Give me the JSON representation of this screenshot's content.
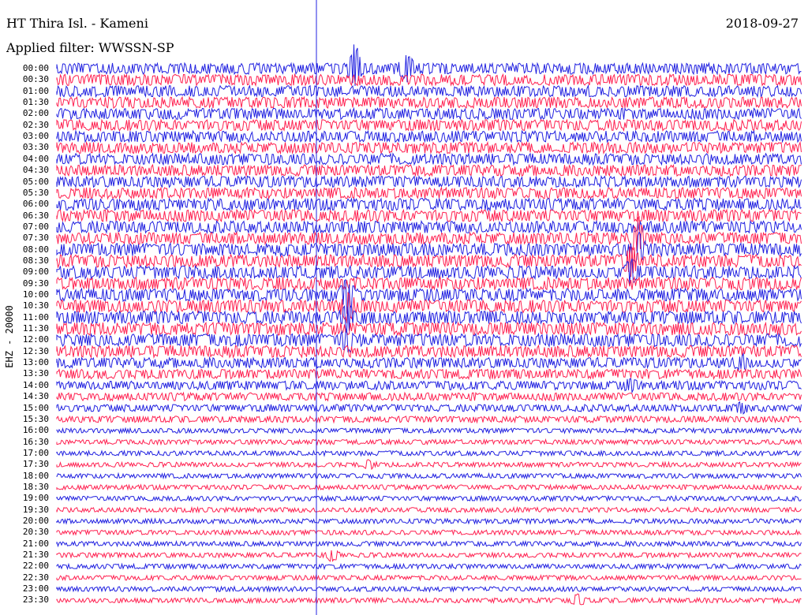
{
  "header": {
    "station": "HT Thira Isl. - Kameni",
    "date": "2018-09-27",
    "filter": "Applied filter: WWSSN-SP"
  },
  "chart_data": {
    "type": "line",
    "title": "HT Thira Isl. - Kameni",
    "ylabel": "EHZ - 20000",
    "row_labels": [
      "00:00",
      "00:30",
      "01:00",
      "01:30",
      "02:00",
      "02:30",
      "03:00",
      "03:30",
      "04:00",
      "04:30",
      "05:00",
      "05:30",
      "06:00",
      "06:30",
      "07:00",
      "07:30",
      "08:00",
      "08:30",
      "09:00",
      "09:30",
      "10:00",
      "10:30",
      "11:00",
      "11:30",
      "12:00",
      "12:30",
      "13:00",
      "13:30",
      "14:00",
      "14:30",
      "15:00",
      "15:30",
      "16:00",
      "16:30",
      "17:00",
      "17:30",
      "18:00",
      "18:30",
      "19:00",
      "19:30",
      "20:00",
      "20:30",
      "21:00",
      "21:30",
      "22:00",
      "22:30",
      "23:00",
      "23:30"
    ],
    "trace_colors": [
      "#2020e0",
      "#ff2050"
    ],
    "row_amplitude": [
      14,
      14,
      14,
      14,
      14,
      14,
      14,
      14,
      14,
      14,
      14,
      14,
      15,
      15,
      15,
      15,
      16,
      16,
      16,
      16,
      16,
      16,
      16,
      16,
      16,
      15,
      13,
      12,
      11,
      10,
      9,
      8,
      6,
      6,
      6,
      6,
      6,
      6,
      6,
      6,
      6,
      6,
      6,
      6,
      6,
      6,
      6,
      6
    ],
    "events": [
      {
        "row": 0,
        "x": 0.4,
        "amp": 60
      },
      {
        "row": 0,
        "x": 0.47,
        "amp": 28
      },
      {
        "row": 15,
        "x": 0.78,
        "amp": 50
      },
      {
        "row": 16,
        "x": 0.78,
        "amp": 40
      },
      {
        "row": 17,
        "x": 0.77,
        "amp": 35
      },
      {
        "row": 18,
        "x": 0.77,
        "amp": 30
      },
      {
        "row": 20,
        "x": 0.39,
        "amp": 40
      },
      {
        "row": 21,
        "x": 0.39,
        "amp": 35
      },
      {
        "row": 22,
        "x": 0.39,
        "amp": 30
      },
      {
        "row": 24,
        "x": 0.39,
        "amp": 25
      },
      {
        "row": 26,
        "x": 0.92,
        "amp": 14
      },
      {
        "row": 28,
        "x": 0.77,
        "amp": 12
      },
      {
        "row": 30,
        "x": 0.92,
        "amp": 10
      },
      {
        "row": 35,
        "x": 0.42,
        "amp": 10
      },
      {
        "row": 43,
        "x": 0.37,
        "amp": 14
      },
      {
        "row": 47,
        "x": 0.7,
        "amp": 14
      }
    ]
  }
}
